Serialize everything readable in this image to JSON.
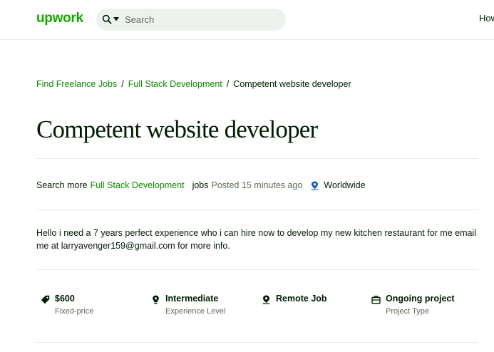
{
  "header": {
    "logo": "upwork",
    "search_placeholder": "Search",
    "nav_partial": "How"
  },
  "breadcrumb": [
    {
      "label": "Find Freelance Jobs"
    },
    {
      "label": "Full Stack Development"
    },
    {
      "label": "Competent website developer"
    }
  ],
  "breadcrumb_separator": "/",
  "job": {
    "title": "Competent website developer",
    "meta": {
      "search_more": "Search more",
      "category": "Full Stack Development",
      "jobs": "jobs",
      "posted": "Posted 15 minutes ago",
      "location": "Worldwide"
    },
    "description": "Hello i need a 7 years perfect experience who i can hire now to develop my new kitchen restaurant for me email me at larryavenger159@gmail.com for more info.",
    "features": [
      {
        "icon": "tag-icon",
        "label": "$600",
        "sub": "Fixed-price"
      },
      {
        "icon": "lightbulb-icon",
        "label": "Intermediate",
        "sub": "Experience Level"
      },
      {
        "icon": "location-pin-icon",
        "label": "Remote Job",
        "sub": ""
      },
      {
        "icon": "briefcase-icon",
        "label": "Ongoing project",
        "sub": "Project Type"
      }
    ]
  },
  "colors": {
    "brand_green": "#14a800",
    "link_green": "#108a00",
    "text": "#001e00",
    "muted": "#5e6d55",
    "divider": "#e4ebe4",
    "location_blue": "#1f57c3"
  }
}
